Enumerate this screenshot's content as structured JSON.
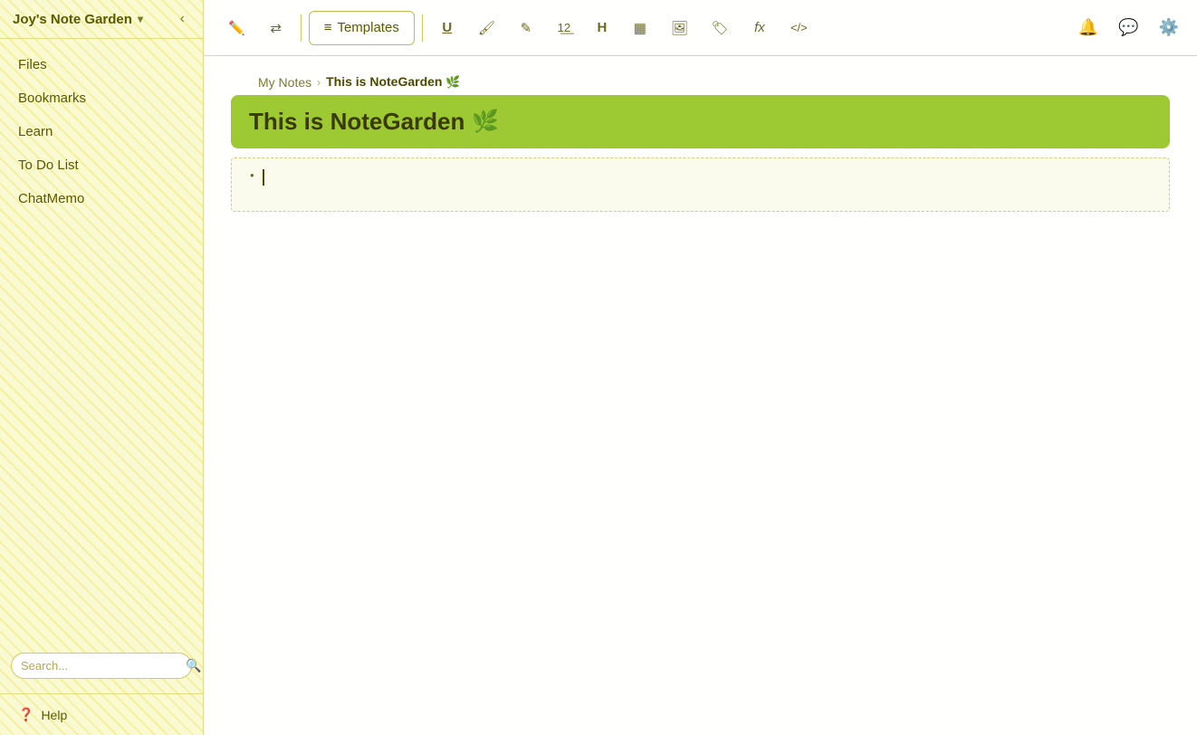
{
  "sidebar": {
    "app_name": "Joy's Note Garden",
    "dropdown_icon": "▾",
    "collapse_icon": "‹",
    "nav_items": [
      {
        "id": "files",
        "label": "Files"
      },
      {
        "id": "bookmarks",
        "label": "Bookmarks"
      },
      {
        "id": "learn",
        "label": "Learn"
      },
      {
        "id": "todo",
        "label": "To Do List"
      },
      {
        "id": "chatmemo",
        "label": "ChatMemo"
      }
    ],
    "search_placeholder": "Search...",
    "help_label": "Help"
  },
  "topbar": {
    "toolbar": {
      "pen_icon": "✏",
      "arrows_icon": "⇄",
      "templates_icon": "≡",
      "templates_label": "Templates",
      "underline_icon": "U",
      "highlight_icon": "▲",
      "edit_icon": "✎",
      "list_icon": "≡",
      "heading_icon": "H",
      "table_icon": "▦",
      "image_icon": "▣",
      "tag_icon": "🏷",
      "formula_icon": "fx",
      "code_icon": "<>"
    },
    "notification_icon": "🔔",
    "chat_icon": "💬",
    "settings_icon": "⚙"
  },
  "breadcrumb": {
    "parent": "My Notes",
    "separator": "›",
    "current": "This is NoteGarden",
    "plant_icon": "🌿"
  },
  "editor": {
    "title": "This is NoteGarden",
    "plant_icon": "🌿",
    "title_bg": "#9dc932",
    "content_placeholder": ""
  }
}
